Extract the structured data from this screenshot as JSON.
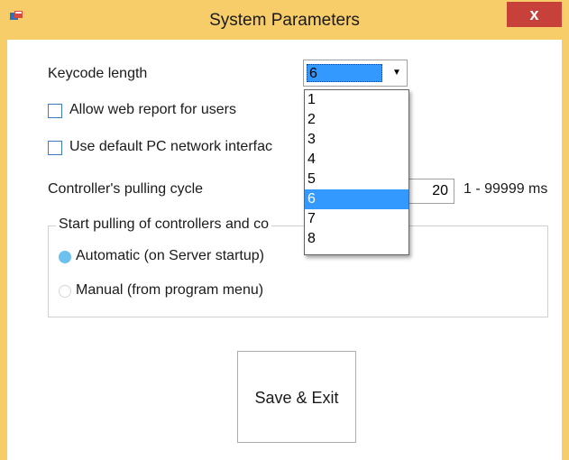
{
  "window": {
    "title": "System Parameters",
    "close_symbol": "x"
  },
  "keycode": {
    "label": "Keycode length",
    "selected": "6",
    "options": [
      "1",
      "2",
      "3",
      "4",
      "5",
      "6",
      "7",
      "8"
    ]
  },
  "checkboxes": {
    "web_report": {
      "label": "Allow web report for users",
      "checked": false
    },
    "default_nic": {
      "label": "Use default PC network interfac",
      "checked": false
    }
  },
  "pulling_cycle": {
    "label": "Controller's pulling cycle",
    "value": "20",
    "range": "1 - 99999 ms"
  },
  "start_pulling": {
    "legend": "Start pulling of controllers and co",
    "automatic": {
      "label": "Automatic (on Server startup)",
      "selected": true
    },
    "manual": {
      "label": "Manual (from program menu)",
      "selected": false
    }
  },
  "save_button": {
    "label": "Save & Exit"
  },
  "colors": {
    "title_bar": "#f7cd6a",
    "close_button": "#c7403a",
    "selection": "#3399ff",
    "radio_selected": "#6cc2ef"
  }
}
